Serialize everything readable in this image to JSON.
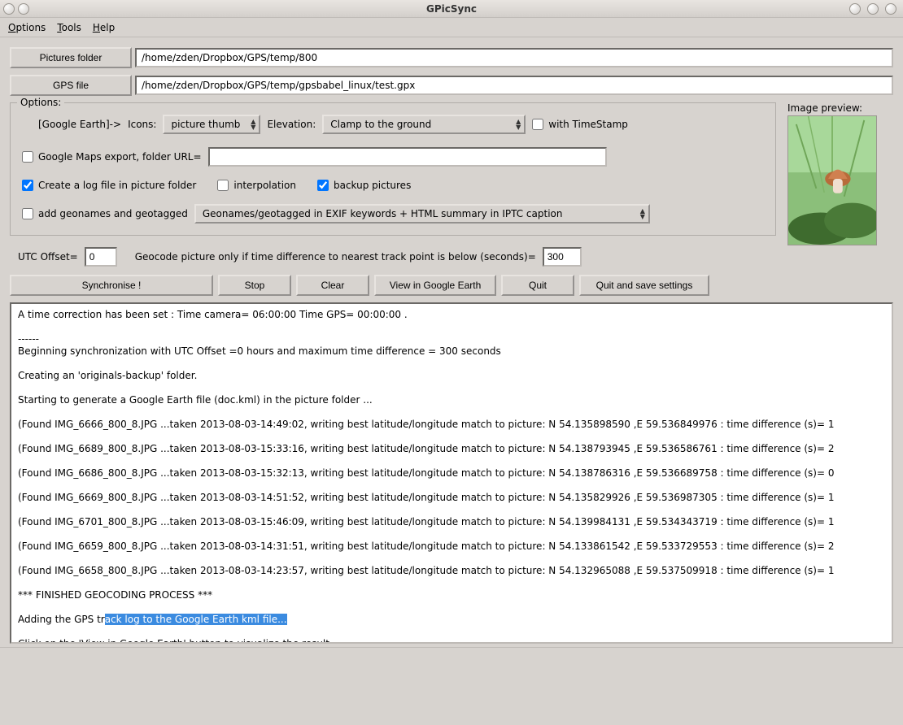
{
  "window_title": "GPicSync",
  "menu": {
    "options": "Options",
    "tools": "Tools",
    "help": "Help"
  },
  "file_pickers": {
    "pictures_label": "Pictures folder",
    "pictures_value": "/home/zden/Dropbox/GPS/temp/800",
    "gps_label": "GPS file",
    "gps_value": "/home/zden/Dropbox/GPS/temp/gpsbabel_linux/test.gpx"
  },
  "options": {
    "legend": "Options:",
    "ge_prefix": "[Google Earth]->",
    "icons_label": "Icons:",
    "icons_value": "picture thumb",
    "elevation_label": "Elevation:",
    "elevation_value": "Clamp to the ground",
    "with_timestamp": "with TimeStamp",
    "gmaps_label": "Google Maps export, folder URL=",
    "gmaps_url": "",
    "create_log": "Create a log file in picture folder",
    "interpolation": "interpolation",
    "backup": "backup pictures",
    "geonames_chk": "add geonames and geotagged",
    "geonames_mode": "Geonames/geotagged in EXIF keywords + HTML summary in IPTC caption"
  },
  "preview_label": "Image preview:",
  "utc": {
    "offset_label": "UTC Offset=",
    "offset_value": "0",
    "geocode_label": "Geocode picture only if time difference to nearest track point is below (seconds)=",
    "seconds_value": "300"
  },
  "actions": {
    "synchronise": "Synchronise !",
    "stop": "Stop",
    "clear": "Clear",
    "view_ge": "View in Google Earth",
    "quit": "Quit",
    "quit_save": "Quit and save settings"
  },
  "checked": {
    "with_timestamp": false,
    "gmaps": false,
    "create_log": true,
    "interpolation": false,
    "backup": true,
    "geonames": false
  },
  "log": {
    "pre1": "A time correction has been set : Time camera= 06:00:00 Time GPS= 00:00:00 .\n\n------\nBeginning synchronization with UTC Offset =0 hours and maximum time difference = 300 seconds\n\nCreating an 'originals-backup' folder.\n\nStarting to generate a Google Earth file (doc.kml) in the picture folder ...\n\n(Found IMG_6666_800_8.JPG ...taken 2013-08-03-14:49:02, writing best latitude/longitude match to picture: N 54.135898590 ,E 59.536849976 : time difference (s)= 1\n\n(Found IMG_6689_800_8.JPG ...taken 2013-08-03-15:33:16, writing best latitude/longitude match to picture: N 54.138793945 ,E 59.536586761 : time difference (s)= 2\n\n(Found IMG_6686_800_8.JPG ...taken 2013-08-03-15:32:13, writing best latitude/longitude match to picture: N 54.138786316 ,E 59.536689758 : time difference (s)= 0\n\n(Found IMG_6669_800_8.JPG ...taken 2013-08-03-14:51:52, writing best latitude/longitude match to picture: N 54.135829926 ,E 59.536987305 : time difference (s)= 1\n\n(Found IMG_6701_800_8.JPG ...taken 2013-08-03-15:46:09, writing best latitude/longitude match to picture: N 54.139984131 ,E 59.534343719 : time difference (s)= 1\n\n(Found IMG_6659_800_8.JPG ...taken 2013-08-03-14:31:51, writing best latitude/longitude match to picture: N 54.133861542 ,E 59.533729553 : time difference (s)= 2\n\n(Found IMG_6658_800_8.JPG ...taken 2013-08-03-14:23:57, writing best latitude/longitude match to picture: N 54.132965088 ,E 59.537509918 : time difference (s)= 1\n\n*** FINISHED GEOCODING PROCESS ***\n\nAdding the GPS tr",
    "highlight": "ack log to the Google Earth kml file...",
    "post1": "\n\nClick on the 'View in Google Earth' button to visualize the result.\n( A Google Earth doc.kml file has been created in your picture folder.)"
  }
}
